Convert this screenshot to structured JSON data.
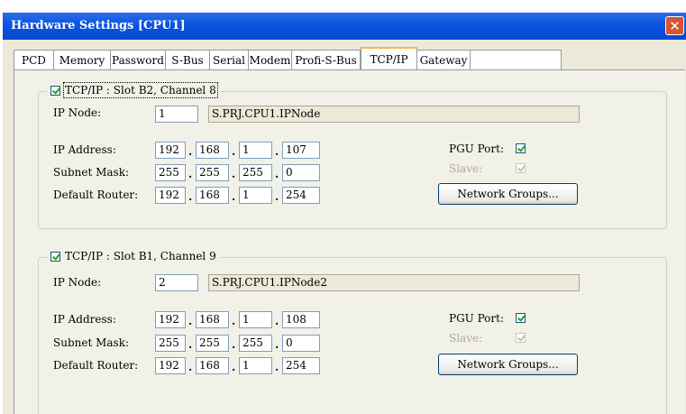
{
  "window": {
    "title": "Hardware Settings [CPU1]"
  },
  "tabs": [
    "PCD",
    "Memory",
    "Password",
    "S-Bus",
    "Serial",
    "Modem",
    "Profi-S-Bus",
    "TCP/IP",
    "Gateway"
  ],
  "active_tab": "TCP/IP",
  "groups": [
    {
      "title": "TCP/IP : Slot B2, Channel 8",
      "enabled": true,
      "ip_node_label": "IP Node:",
      "ip_node": "1",
      "symbol": "S.PRJ.CPU1.IPNode",
      "ip_address_label": "IP Address:",
      "ip_address": [
        "192",
        "168",
        "1",
        "107"
      ],
      "subnet_mask_label": "Subnet Mask:",
      "subnet_mask": [
        "255",
        "255",
        "255",
        "0"
      ],
      "default_router_label": "Default Router:",
      "default_router": [
        "192",
        "168",
        "1",
        "254"
      ],
      "pgu_port_label": "PGU Port:",
      "pgu_port": true,
      "slave_label": "Slave:",
      "slave": true,
      "network_groups_label": "Network Groups..."
    },
    {
      "title": "TCP/IP : Slot B1, Channel 9",
      "enabled": true,
      "ip_node_label": "IP Node:",
      "ip_node": "2",
      "symbol": "S.PRJ.CPU1.IPNode2",
      "ip_address_label": "IP Address:",
      "ip_address": [
        "192",
        "168",
        "1",
        "108"
      ],
      "subnet_mask_label": "Subnet Mask:",
      "subnet_mask": [
        "255",
        "255",
        "255",
        "0"
      ],
      "default_router_label": "Default Router:",
      "default_router": [
        "192",
        "168",
        "1",
        "254"
      ],
      "pgu_port_label": "PGU Port:",
      "pgu_port": true,
      "slave_label": "Slave:",
      "slave": true,
      "network_groups_label": "Network Groups..."
    }
  ],
  "icons": {
    "close": "close-icon",
    "check": "checkmark-icon"
  },
  "colors": {
    "titlebar": "#0a55e0",
    "close_button": "#d8532b",
    "active_tab_accent": "#f0b94b",
    "checkmark": "#21a121"
  }
}
